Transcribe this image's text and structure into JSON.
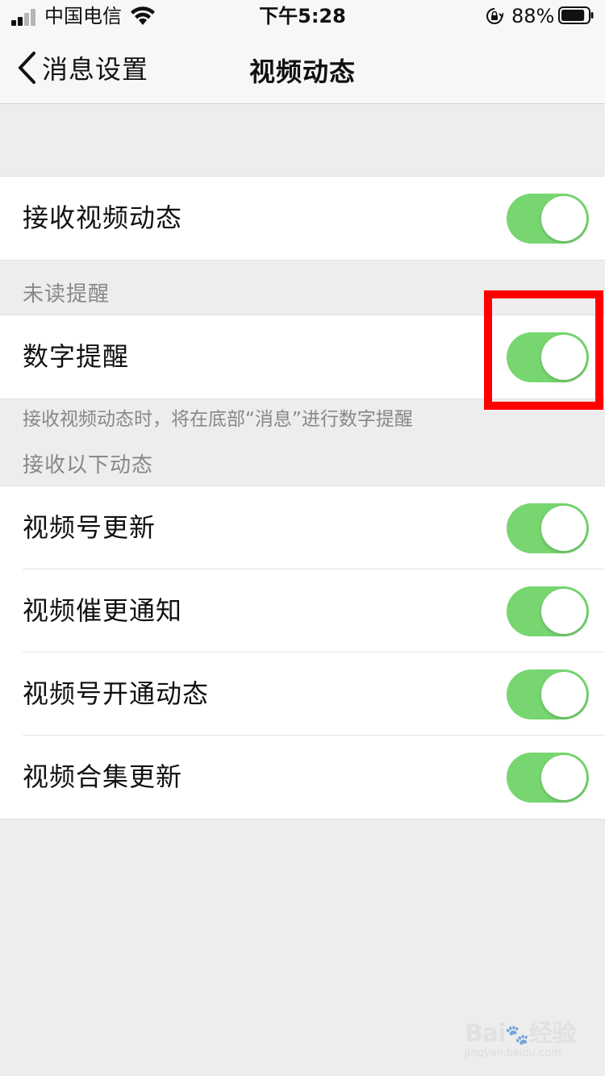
{
  "status_bar": {
    "carrier": "中国电信",
    "time": "下午5:28",
    "battery_percent": "88%",
    "battery_level": 0.88,
    "icons": [
      "signal-icon",
      "wifi-icon",
      "orientation-lock-icon",
      "battery-icon"
    ]
  },
  "nav": {
    "back_label": "消息设置",
    "title": "视频动态"
  },
  "main_toggle": {
    "label": "接收视频动态",
    "on": true
  },
  "unread_section": {
    "header": "未读提醒",
    "items": [
      {
        "label": "数字提醒",
        "on": true
      }
    ],
    "footer": "接收视频动态时，将在底部“消息”进行数字提醒"
  },
  "receive_section": {
    "header": "接收以下动态",
    "items": [
      {
        "label": "视频号更新",
        "on": true
      },
      {
        "label": "视频催更通知",
        "on": true
      },
      {
        "label": "视频号开通动态",
        "on": true
      },
      {
        "label": "视频合集更新",
        "on": true
      }
    ]
  },
  "colors": {
    "toggle_on": "#77d670",
    "background": "#ededed",
    "highlight": "#ff0000"
  },
  "watermark": {
    "logo_text": "Bai du 经验",
    "sub_text": "jingyan.baidu.com"
  }
}
